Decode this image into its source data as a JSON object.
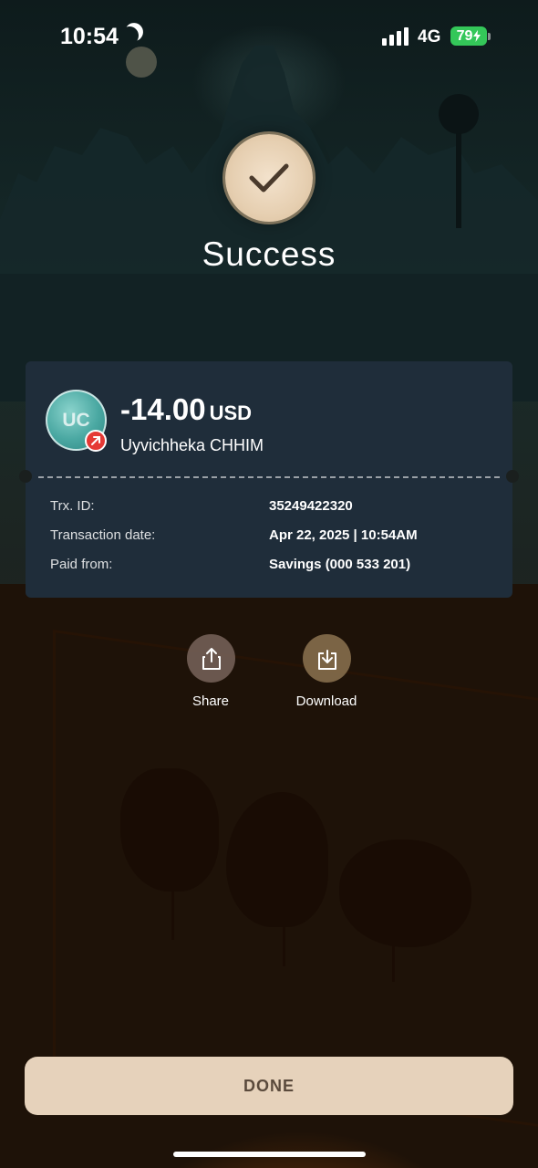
{
  "status_bar": {
    "time": "10:54",
    "network": "4G",
    "battery": "79",
    "icons": [
      "moon-icon",
      "signal-icon",
      "battery-icon"
    ]
  },
  "header": {
    "title": "Success",
    "icon": "checkmark-icon"
  },
  "transaction": {
    "amount": "-14.00",
    "currency": "USD",
    "avatar_initials": "UC",
    "recipient": "Uyvichheka CHHIM",
    "details": [
      {
        "label": "Trx. ID:",
        "value": "35249422320"
      },
      {
        "label": "Transaction date:",
        "value": "Apr 22, 2025 | 10:54AM"
      },
      {
        "label": "Paid from:",
        "value": "Savings (000 533 201)"
      }
    ]
  },
  "actions": {
    "share_label": "Share",
    "download_label": "Download"
  },
  "footer": {
    "done_label": "DONE"
  },
  "colors": {
    "card_bg": "#1f2d3a",
    "done_bg": "#e6d2bb",
    "battery": "#34c759",
    "outgoing_badge": "#e53935"
  }
}
